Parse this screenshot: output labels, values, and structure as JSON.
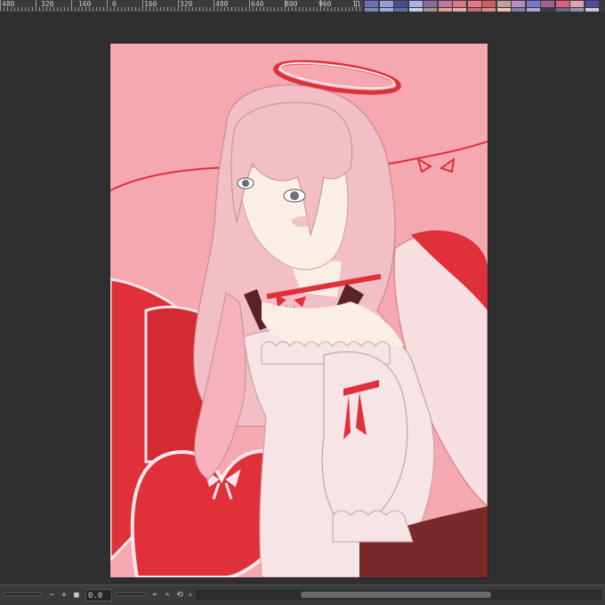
{
  "ruler": {
    "labels": [
      "480",
      "320",
      "160",
      "0",
      "160",
      "320",
      "480",
      "640",
      "800",
      "960",
      "11"
    ]
  },
  "palette": {
    "row1": [
      "#6e6eb8",
      "#9a9ad8",
      "#4c4c8c",
      "#b0b0e8",
      "#8a6aa0",
      "#c078a0",
      "#d87890",
      "#e87888",
      "#d06060",
      "#c0a0a0",
      "#b88cc8",
      "#7878c8",
      "#a06090",
      "#e06080",
      "#e0a0b8",
      "#5050a0"
    ],
    "row2": [
      "#7a8ab8",
      "#98b0d8",
      "#5870a8",
      "#c8d0e8",
      "#a09090",
      "#e0a090",
      "#e0b0a0",
      "#c07070",
      "#d09080",
      "#f0c0b0",
      "#8080a0",
      "#a8a8c8",
      "#3a3a58",
      "#6a6a80",
      "#9090a8",
      "#c8c8d8"
    ],
    "row3": [
      "#b81818",
      "#3a3a3a",
      "#18a018",
      "#3a3a3a",
      "#1818b8"
    ]
  },
  "canvas": {
    "background": "#f5a8b0",
    "accent_red": "#e0303a",
    "hair": "#f2bfc6",
    "skin": "#fbeee6",
    "skirt": "#7a2828"
  },
  "statusbar": {
    "buttons": [
      "−",
      "+",
      "■"
    ],
    "zoom_value": "0.0",
    "rotate_left": "↶",
    "rotate_right": "↷",
    "reset": "⟲",
    "collapse": "‹"
  }
}
